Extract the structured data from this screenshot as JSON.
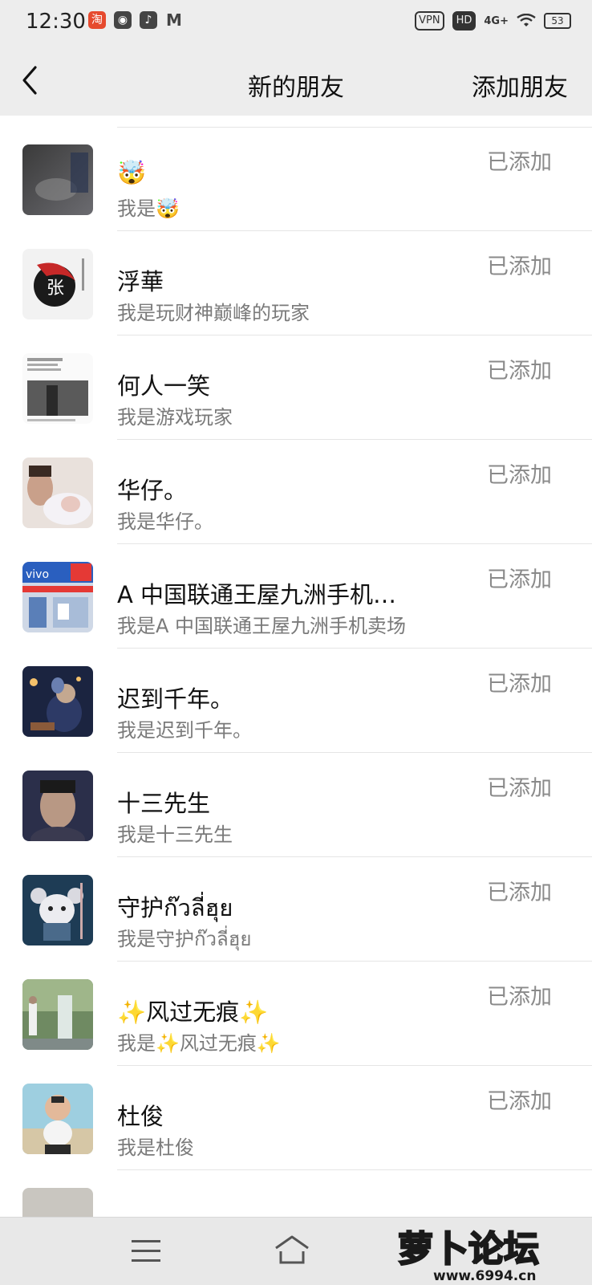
{
  "status_bar": {
    "time": "12:30",
    "app_icons": [
      "taobao-icon",
      "weibo-icon",
      "tiktok-icon",
      "mail-icon"
    ],
    "chips": [
      "VPN",
      "HD"
    ],
    "network": "4G+",
    "battery": "53"
  },
  "nav": {
    "title": "新的朋友",
    "right_action": "添加朋友"
  },
  "friends": [
    {
      "name": "🤯",
      "greeting": "我是🤯",
      "status": "已添加",
      "avatar": "dark-photo"
    },
    {
      "name": "浮華",
      "greeting": "我是玩财神巅峰的玩家",
      "status": "已添加",
      "avatar": "ink-calligraphy"
    },
    {
      "name": "何人一笑",
      "greeting": "我是游戏玩家",
      "status": "已添加",
      "avatar": "text-photo"
    },
    {
      "name": "华仔。",
      "greeting": "我是华仔。",
      "status": "已添加",
      "avatar": "family-photo"
    },
    {
      "name": "A 中国联通王屋九洲手机…",
      "greeting": "我是A 中国联通王屋九洲手机卖场",
      "status": "已添加",
      "avatar": "storefront"
    },
    {
      "name": "迟到千年。",
      "greeting": "我是迟到千年。",
      "status": "已添加",
      "avatar": "night-figure"
    },
    {
      "name": "十三先生",
      "greeting": "我是十三先生",
      "status": "已添加",
      "avatar": "portrait-man"
    },
    {
      "name": "守护ก๊วลี่ฮุย",
      "greeting": "我是守护ก๊วลี่ฮุย",
      "status": "已添加",
      "avatar": "cartoon-mouse"
    },
    {
      "name": "✨风过无痕✨",
      "greeting": "我是✨风过无痕✨",
      "status": "已添加",
      "avatar": "waterfall"
    },
    {
      "name": "杜俊",
      "greeting": "我是杜俊",
      "status": "已添加",
      "avatar": "beach-kid"
    }
  ],
  "watermark": {
    "text": "萝卜论坛",
    "url": "www.6994.cn"
  },
  "colors": {
    "header_bg": "#ededed",
    "list_bg": "#ffffff",
    "secondary_text": "#7a7a7a",
    "status_text": "#8a8a8a"
  }
}
